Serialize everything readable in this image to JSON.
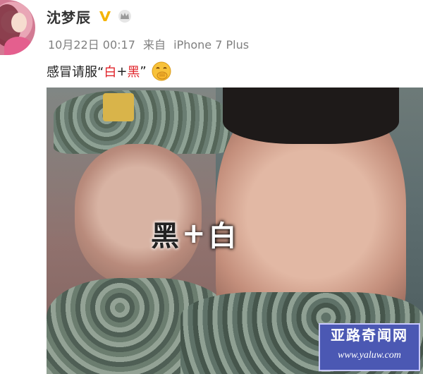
{
  "post": {
    "username": "沈梦辰",
    "timestamp": "10月22日 00:17",
    "source_prefix": "来自",
    "device": "iPhone 7 Plus",
    "text_prefix": "感冒请服“",
    "text_red1": "白",
    "text_plus": "+",
    "text_red2": "黑",
    "text_suffix": "”",
    "icons": {
      "verified": "verified-v-icon",
      "crown": "crown-icon",
      "emoji": "hand-over-mouth-emoji-icon"
    }
  },
  "photo": {
    "overlay_char1": "黑",
    "overlay_plus": "+",
    "overlay_char2": "白"
  },
  "watermark": {
    "title": "亚路奇闻网",
    "url": "www.yaluw.com"
  },
  "colors": {
    "red_text": "#e0232a",
    "verified_yellow": "#f4b400",
    "watermark_bg": "#4b58b3"
  }
}
